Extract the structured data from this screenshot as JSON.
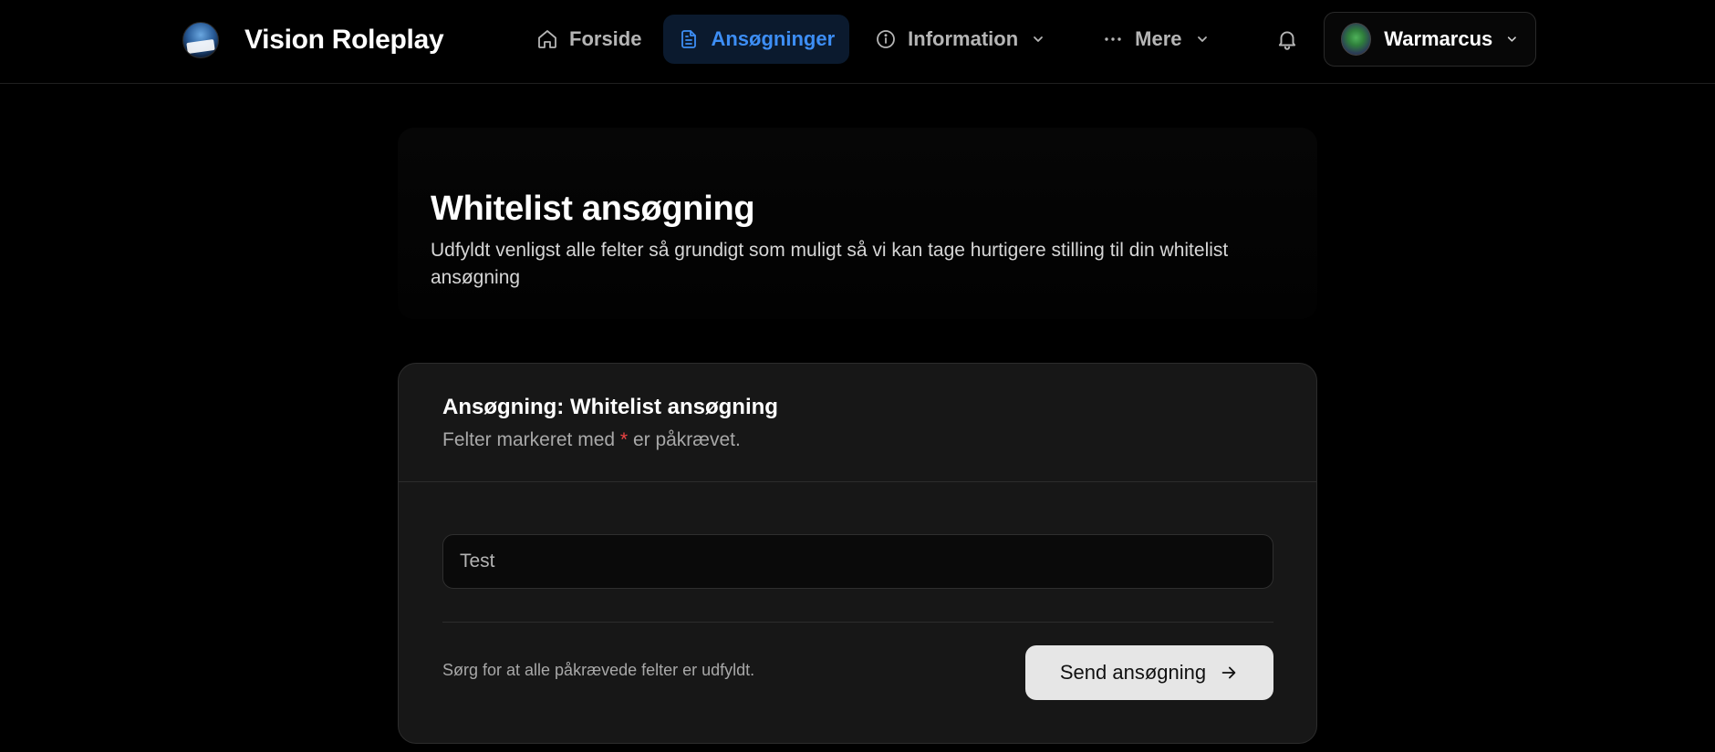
{
  "brand": {
    "name": "Vision Roleplay",
    "logo_icon": "vision-roleplay-logo"
  },
  "nav": {
    "items": [
      {
        "label": "Forside",
        "icon": "home-icon"
      },
      {
        "label": "Ansøgninger",
        "icon": "document-icon",
        "active": true
      },
      {
        "label": "Information",
        "icon": "info-icon",
        "has_dropdown": true
      },
      {
        "label": "Mere",
        "icon": "more-dots-icon",
        "has_dropdown": true
      }
    ]
  },
  "user": {
    "name": "Warmarcus",
    "notification_icon": "bell-icon"
  },
  "hero": {
    "title": "Whitelist ansøgning",
    "description": "Udfyldt venligst alle felter så grundigt som muligt så vi kan tage hurtigere stilling til din whitelist ansøgning"
  },
  "form": {
    "title": "Ansøgning: Whitelist ansøgning",
    "required_prefix": "Felter markeret med",
    "required_marker": "*",
    "required_suffix": "er påkrævet.",
    "field_value": "Test",
    "footer_note": "Sørg for at alle påkrævede felter er udfyldt.",
    "submit_label": "Send ansøgning"
  },
  "colors": {
    "background": "#000000",
    "accent": "#3d8ef5",
    "active_nav_bg": "#0b1a2e",
    "card_bg": "#171717",
    "required": "#ef4444",
    "button_bg": "#e6e6e6"
  }
}
